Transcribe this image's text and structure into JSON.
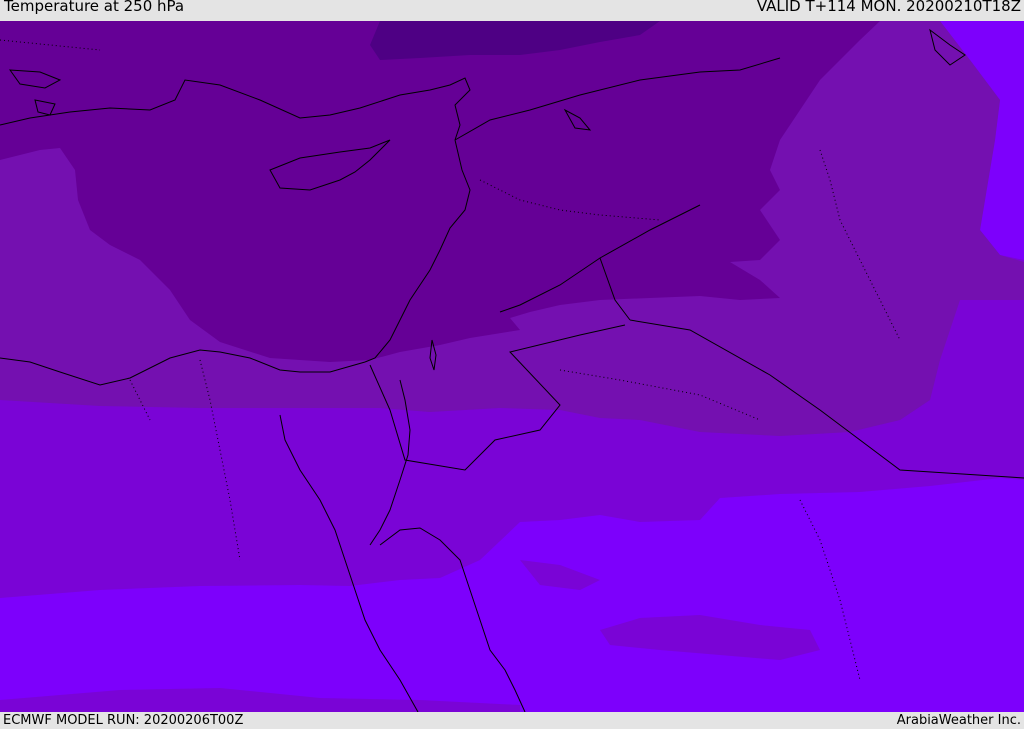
{
  "header": {
    "title": "Temperature at 250 hPa",
    "valid_time": "VALID T+114 MON. 20200210T18Z"
  },
  "footer": {
    "model_run": "ECMWF MODEL RUN: 20200206T00Z",
    "credit": "ArabiaWeather Inc."
  },
  "map": {
    "field": "temperature",
    "level_hpa": 250,
    "region": "Eastern Mediterranean / Middle East",
    "palette": {
      "deep_purple": "#4e0084",
      "dark_purple": "#650096",
      "mid_purple": "#7410b0",
      "violet": "#7a04d6",
      "bright_violet": "#7d00fc",
      "coast_line": "#000000"
    }
  }
}
